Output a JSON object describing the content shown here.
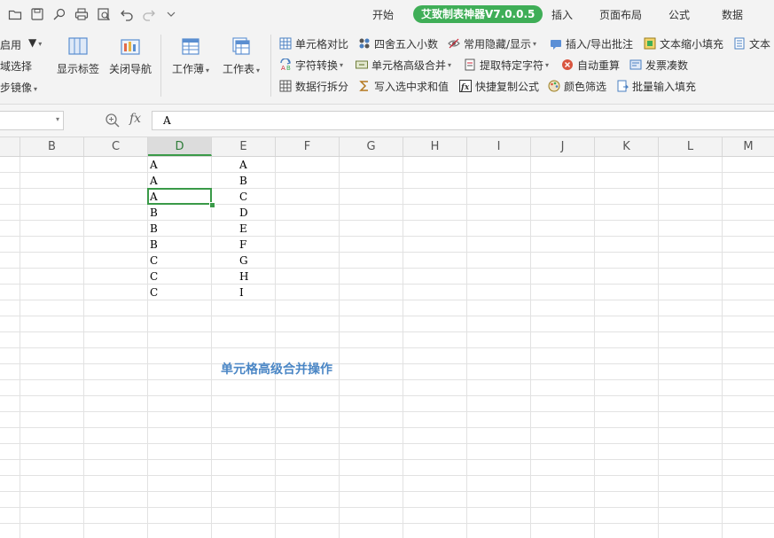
{
  "menu": {
    "tabs": [
      "开始",
      "艾致制表神器V7.0.0.5",
      "插入",
      "页面布局",
      "公式",
      "数据"
    ],
    "active_index": 1
  },
  "ribbon": {
    "left_group": {
      "item1": "启用",
      "item2": "域选择",
      "item3": "步镜像"
    },
    "show_tabs_label": "显示标签",
    "close_nav_label": "关闭导航",
    "workbook_label": "工作薄",
    "worksheet_label": "工作表",
    "row1": [
      "单元格对比",
      "四舍五入小数",
      "常用隐藏/显示",
      "插入/导出批注",
      "文本缩小填充",
      "文本"
    ],
    "row2": [
      "字符转换",
      "单元格高级合并",
      "提取特定字符",
      "自动重算",
      "发票凑数"
    ],
    "row3": [
      "数据行拆分",
      "写入选中求和值",
      "快捷复制公式",
      "颜色筛选",
      "批量输入填充"
    ]
  },
  "formula_bar": {
    "fx_label": "fx",
    "value": "A"
  },
  "columns": [
    "B",
    "C",
    "D",
    "E",
    "F",
    "G",
    "H",
    "I",
    "J",
    "K",
    "L",
    "M"
  ],
  "selected_column": "D",
  "cells": {
    "D": [
      "A",
      "A",
      "A",
      "B",
      "B",
      "B",
      "C",
      "C",
      "C"
    ],
    "E": [
      "A",
      "B",
      "C",
      "D",
      "E",
      "F",
      "G",
      "H",
      "I"
    ]
  },
  "caption": "单元格高级合并操作",
  "colors": {
    "accent_green": "#3fae57",
    "selection_green": "#3a9a48",
    "caption_blue": "#4a86c5"
  }
}
